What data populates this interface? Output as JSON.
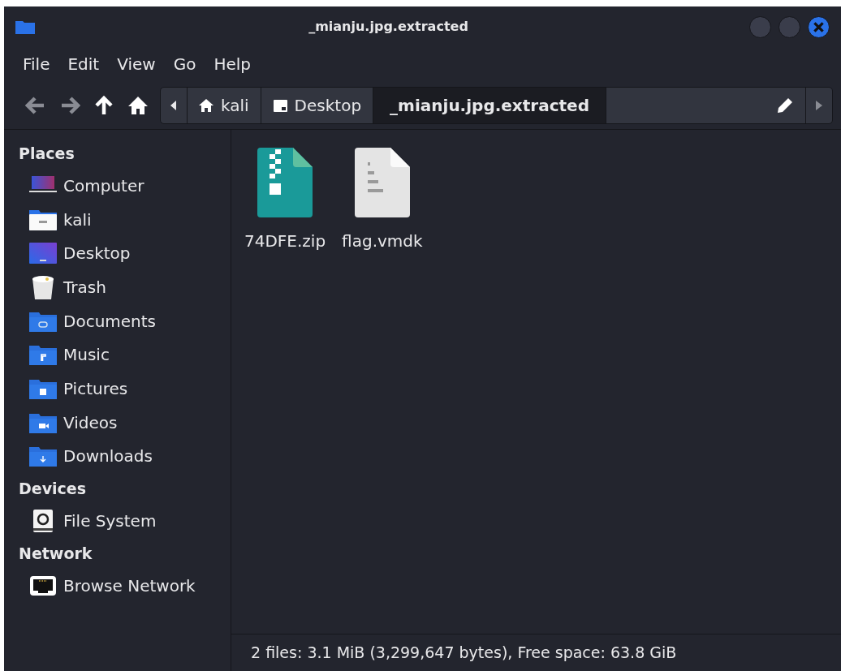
{
  "window": {
    "title": "_mianju.jpg.extracted"
  },
  "menu": [
    "File",
    "Edit",
    "View",
    "Go",
    "Help"
  ],
  "nav_buttons": [
    {
      "kind": "back",
      "disabled": true
    },
    {
      "kind": "forward",
      "disabled": true
    },
    {
      "kind": "up",
      "disabled": false
    },
    {
      "kind": "home",
      "disabled": false
    }
  ],
  "path_bar": [
    {
      "label": "kali",
      "kind": "home",
      "selected": false
    },
    {
      "label": "Desktop",
      "kind": "desktop",
      "selected": false
    },
    {
      "label": "_mianju.jpg.extracted",
      "kind": "folder",
      "selected": true
    }
  ],
  "sidebar": [
    {
      "heading": "Places",
      "items": [
        {
          "label": "Computer",
          "kind": "computer"
        },
        {
          "label": "kali",
          "kind": "home"
        },
        {
          "label": "Desktop",
          "kind": "desktop"
        },
        {
          "label": "Trash",
          "kind": "trash"
        },
        {
          "label": "Documents",
          "kind": "documents"
        },
        {
          "label": "Music",
          "kind": "music"
        },
        {
          "label": "Pictures",
          "kind": "pictures"
        },
        {
          "label": "Videos",
          "kind": "videos"
        },
        {
          "label": "Downloads",
          "kind": "downloads"
        }
      ]
    },
    {
      "heading": "Devices",
      "items": [
        {
          "label": "File System",
          "kind": "drive"
        }
      ]
    },
    {
      "heading": "Network",
      "items": [
        {
          "label": "Browse Network",
          "kind": "network"
        }
      ]
    }
  ],
  "files": [
    {
      "name": "74DFE.zip",
      "kind": "zip"
    },
    {
      "name": "flag.vmdk",
      "kind": "binary"
    }
  ],
  "status_bar": "2 files: 3.1 MiB (3,299,647 bytes), Free space: 63.8 GiB"
}
